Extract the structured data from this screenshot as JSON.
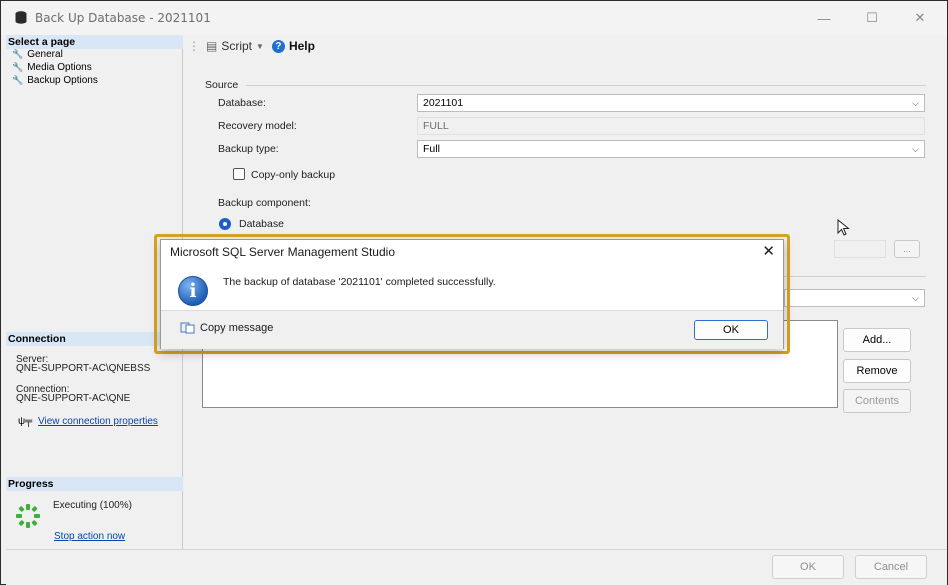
{
  "window": {
    "title": "Back Up Database - 2021101",
    "minimize": "—",
    "maximize": "☐",
    "close": "✕"
  },
  "left": {
    "select_page_header": "Select a page",
    "pages": [
      {
        "label": "General",
        "icon": "wrench-icon"
      },
      {
        "label": "Media Options",
        "icon": "wrench-icon"
      },
      {
        "label": "Backup Options",
        "icon": "wrench-icon"
      }
    ],
    "connection_header": "Connection",
    "server_label": "Server:",
    "server_value": "QNE-SUPPORT-AC\\QNEBSS",
    "connection_label": "Connection:",
    "connection_value": "QNE-SUPPORT-AC\\QNE",
    "view_connection_link": "View connection properties",
    "progress_header": "Progress",
    "progress_status": "Executing (100%)",
    "progress_value": 1.0,
    "stop_action_link": "Stop action now"
  },
  "toolbar": {
    "script_label": "Script",
    "help_label": "Help"
  },
  "form": {
    "source_label": "Source",
    "database_label": "Database:",
    "database_value": "2021101",
    "recovery_label": "Recovery model:",
    "recovery_value": "FULL",
    "backup_type_label": "Backup type:",
    "backup_type_value": "Full",
    "copy_only_label": "Copy-only backup",
    "copy_only_checked": false,
    "component_label": "Backup component:",
    "component_database": "Database",
    "browse_label": "...",
    "add_label": "Add...",
    "remove_label": "Remove",
    "contents_label": "Contents"
  },
  "footer": {
    "ok_label": "OK",
    "cancel_label": "Cancel"
  },
  "dialog": {
    "title": "Microsoft SQL Server Management Studio",
    "close": "✕",
    "message": "The backup of database '2021101' completed successfully.",
    "copy_message_label": "Copy message",
    "ok_label": "OK",
    "info_glyph": "i"
  },
  "colors": {
    "accent": "#1e6fd0",
    "dialog_highlight": "#d9a520",
    "link": "#0645ad",
    "header_bg": "#d9e6f5"
  }
}
